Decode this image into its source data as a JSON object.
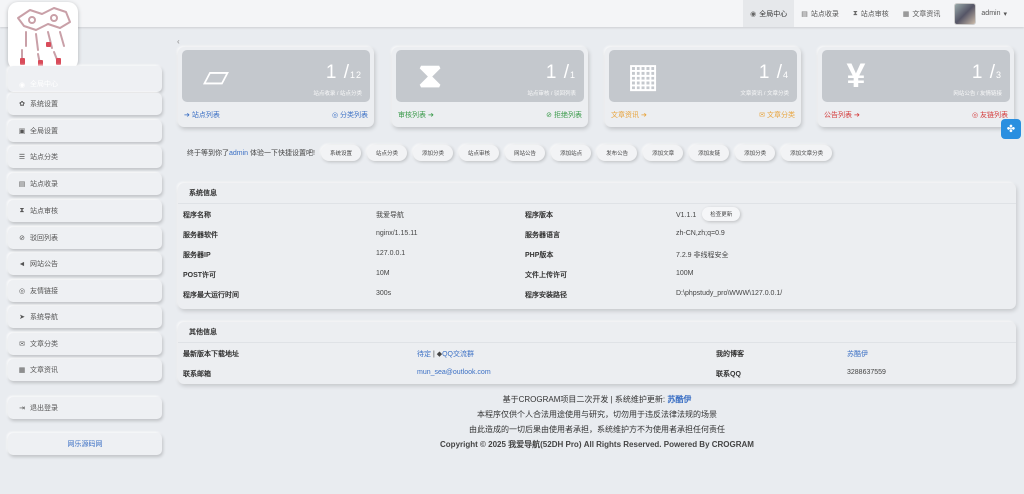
{
  "topbar": {
    "items": [
      {
        "icon": "dashboard-icon",
        "glyph": "◉",
        "label": "全局中心",
        "active": true
      },
      {
        "icon": "book-icon",
        "glyph": "▤",
        "label": "站点收录"
      },
      {
        "icon": "hourglass-icon",
        "glyph": "⧗",
        "label": "站点审核"
      },
      {
        "icon": "newspaper-icon",
        "glyph": "▦",
        "label": "文章资讯"
      }
    ],
    "user": {
      "name": "admin",
      "caret": "▾"
    }
  },
  "sidebar": {
    "collapse_arrow": "‹",
    "items": [
      {
        "icon": "dashboard-icon",
        "glyph": "◉",
        "label": "全局中心"
      },
      {
        "icon": "gear-icon",
        "glyph": "✿",
        "label": "系统设置"
      },
      {
        "icon": "image-icon",
        "glyph": "▣",
        "label": "全局设置"
      },
      {
        "icon": "sort-icon",
        "glyph": "☰",
        "label": "站点分类"
      },
      {
        "icon": "book-icon",
        "glyph": "▤",
        "label": "站点收录"
      },
      {
        "icon": "hourglass-icon",
        "glyph": "⧗",
        "label": "站点审核"
      },
      {
        "icon": "ban-icon",
        "glyph": "⊘",
        "label": "驳回列表"
      },
      {
        "icon": "bullhorn-icon",
        "glyph": "◄",
        "label": "网站公告"
      },
      {
        "icon": "eye-icon",
        "glyph": "◎",
        "label": "友情链接"
      },
      {
        "icon": "location-arrow-icon",
        "glyph": "➤",
        "label": "系统导航"
      },
      {
        "icon": "envelope-icon",
        "glyph": "✉",
        "label": "文章分类"
      },
      {
        "icon": "newspaper-icon",
        "glyph": "▦",
        "label": "文章资讯"
      },
      {
        "icon": "logout-icon",
        "glyph": "⇥",
        "label": "退出登录"
      }
    ],
    "bottom_link": "网乐源码网"
  },
  "stats": [
    {
      "icon": "book-icon",
      "glyph": "▱",
      "value": "1",
      "total": "12",
      "label": "站点收录 / 站点分类",
      "left_link": {
        "glyph": "➔",
        "label": "站点列表",
        "color": "#3a6fc4"
      },
      "right_link": {
        "glyph": "◎",
        "label": "分类列表",
        "color": "#3a6fc4"
      }
    },
    {
      "icon": "hourglass-icon",
      "glyph": "⧗",
      "value": "1",
      "total": "1",
      "label": "站点审核 / 驳回列表",
      "left_link": {
        "glyph": "➔",
        "label": "审核列表",
        "color": "#3a9a4a"
      },
      "right_link": {
        "glyph": "⊘",
        "label": "拒绝列表",
        "color": "#3a9a4a"
      }
    },
    {
      "icon": "newspaper-icon",
      "glyph": "▦",
      "value": "1",
      "total": "4",
      "label": "文章资讯 / 文章分类",
      "left_link": {
        "glyph": "➔",
        "label": "文章资讯",
        "color": "#e8a33a"
      },
      "right_link": {
        "glyph": "✉",
        "label": "文章分类",
        "color": "#e8a33a"
      }
    },
    {
      "icon": "yen-icon",
      "glyph": "¥",
      "value": "1",
      "total": "3",
      "label": "网站公告 / 友情链接",
      "left_link": {
        "glyph": "➔",
        "label": "公告列表",
        "color": "#d43c3c"
      },
      "right_link": {
        "glyph": "◎",
        "label": "友链列表",
        "color": "#d43c3c"
      }
    }
  ],
  "welcome": {
    "prefix": "终于等到你了",
    "user": "admin",
    "suffix": "体验一下快捷设置吧!",
    "shortcuts": [
      "系统设置",
      "站点分类",
      "添加分类",
      "站点审核",
      "网站公告",
      "添加站点",
      "发布公告",
      "添加文章",
      "添加友链",
      "添加分类",
      "添加文章分类"
    ]
  },
  "float_button": {
    "icon": "tool-icon",
    "glyph": "✤"
  },
  "system_info": {
    "title": "系统信息",
    "rows": [
      {
        "k1": "程序名称",
        "v1": "我爱导航",
        "k2": "程序版本",
        "v2": "V1.1.1",
        "button": "检查更新"
      },
      {
        "k1": "服务器软件",
        "v1": "nginx/1.15.11",
        "k2": "服务器语言",
        "v2": "zh-CN,zh;q=0.9"
      },
      {
        "k1": "服务器IP",
        "v1": "127.0.0.1",
        "k2": "PHP版本",
        "v2": "7.2.9 非线程安全"
      },
      {
        "k1": "POST许可",
        "v1": "10M",
        "k2": "文件上传许可",
        "v2": "100M"
      },
      {
        "k1": "程序最大运行时间",
        "v1": "300s",
        "k2": "程序安装路径",
        "v2": "D:\\phpstudy_pro\\WWW\\127.0.0.1/"
      }
    ]
  },
  "other_info": {
    "title": "其他信息",
    "rows": [
      {
        "k1": "最新版本下载地址",
        "v1a": "待定",
        "sep": " | ",
        "qq_glyph": "◆",
        "v1b": "QQ交流群",
        "k2": "我的博客",
        "v2": "苏酷伊"
      },
      {
        "k1": "联系邮箱",
        "v1a": "mun_sea@outlook.com",
        "k2": "联系QQ",
        "v2": "3288637559"
      }
    ]
  },
  "footer": {
    "line1_prefix": "基于CROGRAM项目二次开发 | 系统维护更新: ",
    "line1_author": "苏酷伊",
    "line2": "本程序仅供个人合法用途使用与研究，切勿用于违反法律法规的场景",
    "line3": "由此造成的一切后果由使用者承担，系统维护方不为使用者承担任何责任",
    "copyright": "Copyright © 2025 我爱导航(52DH Pro) All Rights Reserved. Powered By CROGRAM"
  }
}
